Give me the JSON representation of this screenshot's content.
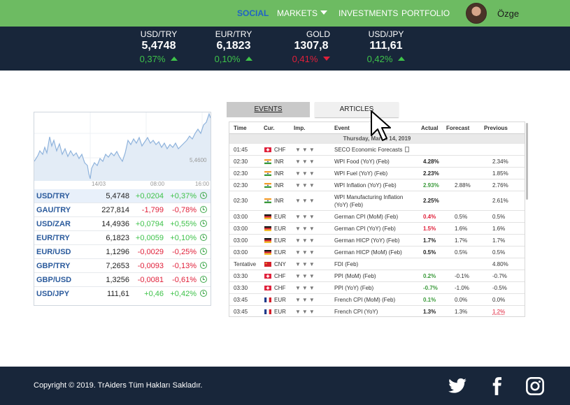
{
  "nav": {
    "items": [
      {
        "label": "SOCIAL",
        "active": true
      },
      {
        "label": "MARKETS"
      },
      {
        "label": "INVESTMENTS"
      },
      {
        "label": "PORTFOLIO"
      }
    ],
    "user": "Özge"
  },
  "ticker": [
    {
      "label": "USD/TRY",
      "value": "5,4748",
      "change": "0,37%",
      "direction": "up"
    },
    {
      "label": "EUR/TRY",
      "value": "6,1823",
      "change": "0,10%",
      "direction": "up"
    },
    {
      "label": "GOLD",
      "value": "1307,8",
      "change": "0,41%",
      "direction": "down"
    },
    {
      "label": "USD/JPY",
      "value": "111,61",
      "change": "0,42%",
      "direction": "up"
    }
  ],
  "chart": {
    "x_labels": [
      "14/03",
      "08:00",
      "16:00"
    ],
    "y_label": "5,4600"
  },
  "rates": [
    {
      "pair": "USD/TRY",
      "value": "5,4748",
      "change": "+0,0204",
      "pct": "+0,37%",
      "dir": "up"
    },
    {
      "pair": "GAU/TRY",
      "value": "227,814",
      "change": "-1,799",
      "pct": "-0,78%",
      "dir": "down"
    },
    {
      "pair": "USD/ZAR",
      "value": "14,4936",
      "change": "+0,0794",
      "pct": "+0,55%",
      "dir": "up"
    },
    {
      "pair": "EUR/TRY",
      "value": "6,1823",
      "change": "+0,0059",
      "pct": "+0,10%",
      "dir": "up"
    },
    {
      "pair": "EUR/USD",
      "value": "1,1296",
      "change": "-0,0029",
      "pct": "-0,25%",
      "dir": "down"
    },
    {
      "pair": "GBP/TRY",
      "value": "7,2653",
      "change": "-0,0093",
      "pct": "-0,13%",
      "dir": "down"
    },
    {
      "pair": "GBP/USD",
      "value": "1,3256",
      "change": "-0,0081",
      "pct": "-0,61%",
      "dir": "down"
    },
    {
      "pair": "USD/JPY",
      "value": "111,61",
      "change": "+0,46",
      "pct": "+0,42%",
      "dir": "up"
    }
  ],
  "tabs": {
    "events": "EVENTS",
    "articles": "ARTICLES"
  },
  "calendar": {
    "headers": {
      "time": "Time",
      "cur": "Cur.",
      "imp": "Imp.",
      "event": "Event",
      "actual": "Actual",
      "forecast": "Forecast",
      "previous": "Previous"
    },
    "date": "Thursday, March 14, 2019",
    "rows": [
      {
        "time": "01:45",
        "flag": "ch",
        "cur": "CHF",
        "event": "SECO Economic Forecasts",
        "actual": "",
        "forecast": "",
        "previous": "",
        "doc": true
      },
      {
        "time": "02:30",
        "flag": "in",
        "cur": "INR",
        "event": "WPI Food (YoY) (Feb)",
        "actual": "4.28%",
        "actualColor": "#222",
        "forecast": "",
        "previous": "2.34%"
      },
      {
        "time": "02:30",
        "flag": "in",
        "cur": "INR",
        "event": "WPI Fuel (YoY) (Feb)",
        "actual": "2.23%",
        "actualColor": "#222",
        "forecast": "",
        "previous": "1.85%"
      },
      {
        "time": "02:30",
        "flag": "in",
        "cur": "INR",
        "event": "WPI Inflation (YoY) (Feb)",
        "actual": "2.93%",
        "actualColor": "#3a9a3a",
        "forecast": "2.88%",
        "previous": "2.76%"
      },
      {
        "time": "02:30",
        "flag": "in",
        "cur": "INR",
        "event": "WPI Manufacturing Inflation",
        "event2": "(YoY) (Feb)",
        "actual": "2.25%",
        "actualColor": "#222",
        "forecast": "",
        "previous": "2.61%",
        "tall": true
      },
      {
        "time": "03:00",
        "flag": "de",
        "cur": "EUR",
        "event": "German CPI (MoM) (Feb)",
        "actual": "0.4%",
        "actualColor": "#e0203a",
        "forecast": "0.5%",
        "previous": "0.5%"
      },
      {
        "time": "03:00",
        "flag": "de",
        "cur": "EUR",
        "event": "German CPI (YoY) (Feb)",
        "actual": "1.5%",
        "actualColor": "#e0203a",
        "forecast": "1.6%",
        "previous": "1.6%"
      },
      {
        "time": "03:00",
        "flag": "de",
        "cur": "EUR",
        "event": "German HICP (YoY) (Feb)",
        "actual": "1.7%",
        "actualColor": "#222",
        "forecast": "1.7%",
        "previous": "1.7%"
      },
      {
        "time": "03:00",
        "flag": "de",
        "cur": "EUR",
        "event": "German HICP (MoM) (Feb)",
        "actual": "0.5%",
        "actualColor": "#222",
        "forecast": "0.5%",
        "previous": "0.5%"
      },
      {
        "time": "Tentative",
        "flag": "cn",
        "cur": "CNY",
        "event": "FDI (Feb)",
        "actual": "",
        "forecast": "",
        "previous": "4.80%"
      },
      {
        "time": "03:30",
        "flag": "ch",
        "cur": "CHF",
        "event": "PPI (MoM) (Feb)",
        "actual": "0.2%",
        "actualColor": "#3a9a3a",
        "forecast": "-0.1%",
        "previous": "-0.7%"
      },
      {
        "time": "03:30",
        "flag": "ch",
        "cur": "CHF",
        "event": "PPI (YoY) (Feb)",
        "actual": "-0.7%",
        "actualColor": "#3a9a3a",
        "forecast": "-1.0%",
        "previous": "-0.5%"
      },
      {
        "time": "03:45",
        "flag": "fr",
        "cur": "EUR",
        "event": "French CPI (MoM) (Feb)",
        "actual": "0.1%",
        "actualColor": "#3a9a3a",
        "forecast": "0.0%",
        "previous": "0.0%"
      },
      {
        "time": "03:45",
        "flag": "fr",
        "cur": "EUR",
        "event": "French CPI (YoY)",
        "actual": "1.3%",
        "actualColor": "#222",
        "forecast": "1.3%",
        "previous": "1.2%",
        "previousColor": "#e0203a"
      }
    ]
  },
  "footer": {
    "copyright": "Copyright © 2019. TrAiders Tüm Hakları Sakladır.",
    "social": [
      "twitter-icon",
      "facebook-icon",
      "instagram-icon"
    ]
  },
  "colors": {
    "nav": "#6dbb62",
    "dark": "#18263a",
    "positive": "#3ec24a",
    "negative": "#e0203a",
    "accent": "#1f63c6"
  }
}
